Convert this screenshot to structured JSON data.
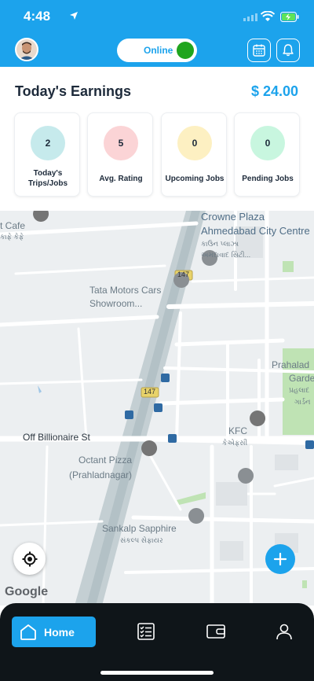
{
  "status_bar": {
    "time": "4:48"
  },
  "header": {
    "online_label": "Online",
    "online": true
  },
  "earnings": {
    "title": "Today's Earnings",
    "amount": "$ 24.00"
  },
  "stats": [
    {
      "value": "2",
      "label": "Today's Trips/Jobs",
      "color": "#c6eaec"
    },
    {
      "value": "5",
      "label": "Avg. Rating",
      "color": "#fbd4d6"
    },
    {
      "value": "0",
      "label": "Upcoming Jobs",
      "color": "#fdf0c2"
    },
    {
      "value": "0",
      "label": "Pending Jobs",
      "color": "#c8f6df"
    }
  ],
  "map": {
    "labels": {
      "cafe": "t Cafe",
      "cafe_local": "કાફે કેફે",
      "crowne": "Crowne Plaza",
      "crowne2": "Ahmedabad City Centre",
      "crowne_local": "કાઉન પ્લાઝા",
      "crowne_local2": "અમદાવાદ સિટી...",
      "tata": "Tata Motors Cars",
      "tata2": "Showroom...",
      "prahalad": "Prahalad",
      "prahalad2": "Garde",
      "prahalad_local": "પ્રહલાદ",
      "prahalad_local2": "ગાર્ડન",
      "road_147_a": "147",
      "road_147_b": "147",
      "billionaire": "Off Billionaire St",
      "kfc": "KFC",
      "kfc_local": "કેએફસી",
      "octant": "Octant Pizza",
      "octant2": "(Prahladnagar)",
      "sankalp": "Sankalp Sapphire",
      "sankalp_local": "સંકલ્પ સેફાયર",
      "google": "Google"
    }
  },
  "nav": {
    "home_label": "Home"
  },
  "colors": {
    "accent": "#1ca3ec",
    "online": "#20a51e",
    "nav_bg": "#0f1519"
  }
}
